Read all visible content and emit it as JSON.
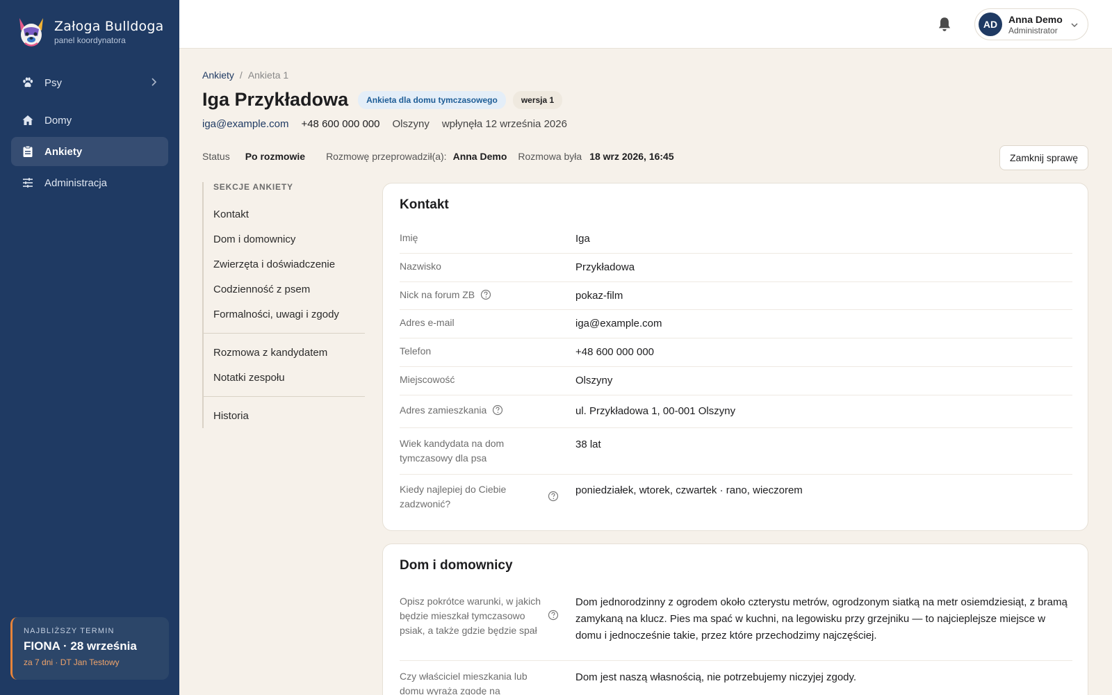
{
  "brand": {
    "title": "Załoga Bulldoga",
    "subtitle": "panel koordynatora"
  },
  "nav": [
    {
      "label": "Psy",
      "icon": "paw-icon"
    },
    {
      "label": "Domy",
      "icon": "home-icon"
    },
    {
      "label": "Ankiety",
      "icon": "clipboard-icon"
    },
    {
      "label": "Administracja",
      "icon": "sliders-icon"
    }
  ],
  "deadline": {
    "label": "NAJBLIŻSZY TERMIN",
    "title": "FIONA · 28 września",
    "meta": "za 7 dni · DT Jan Testowy"
  },
  "user": {
    "initials": "AD",
    "name": "Anna Demo",
    "role": "Administrator"
  },
  "breadcrumb": {
    "root": "Ankiety",
    "sep": "/",
    "current": "Ankieta 1"
  },
  "header": {
    "title": "Iga Przykładowa",
    "type_badge": "Ankieta dla domu tymczasowego",
    "version_badge": "wersja 1",
    "email": "iga@example.com",
    "phone": "+48 600 000 000",
    "city": "Olszyny",
    "submitted": "wpłynęła 12 września 2026"
  },
  "status": {
    "status_label": "Status",
    "status_value": "Po rozmowie",
    "interviewer_label": "Rozmowę przeprowadził(a):",
    "interviewer_value": "Anna Demo",
    "date_label": "Rozmowa była",
    "date_value": "18 wrz 2026, 16:45",
    "close_button": "Zamknij sprawę"
  },
  "sections": {
    "heading": "SEKCJE ANKIETY",
    "group1": [
      "Kontakt",
      "Dom i domownicy",
      "Zwierzęta i doświadczenie",
      "Codzienność z psem",
      "Formalności, uwagi i zgody"
    ],
    "group2": [
      "Rozmowa z kandydatem",
      "Notatki zespołu"
    ],
    "group3": [
      "Historia"
    ]
  },
  "contact": {
    "title": "Kontakt",
    "rows": [
      {
        "label": "Imię",
        "value": "Iga"
      },
      {
        "label": "Nazwisko",
        "value": "Przykładowa"
      },
      {
        "label": "Nick na forum ZB",
        "value": "pokaz-film"
      },
      {
        "label": "Adres e-mail",
        "value": "iga@example.com"
      },
      {
        "label": "Telefon",
        "value": "+48 600 000 000"
      },
      {
        "label": "Miejscowość",
        "value": "Olszyny"
      },
      {
        "label": "Adres zamieszkania",
        "value": "ul. Przykładowa 1, 00-001 Olszyny"
      },
      {
        "label": "Wiek kandydata na dom tymczasowy dla psa",
        "value": "38 lat"
      },
      {
        "label": "Kiedy najlepiej do Ciebie zadzwonić?",
        "value": "poniedziałek, wtorek, czwartek · rano, wieczorem"
      }
    ]
  },
  "home": {
    "title": "Dom i domownicy",
    "rows": [
      {
        "label": "Opisz pokrótce warunki, w jakich będzie mieszkał tymczasowo psiak, a także gdzie będzie spał",
        "value": "Dom jednorodzinny z ogrodem około czterystu metrów, ogrodzonym siatką na metr osiemdziesiąt, z bramą zamykaną na klucz. Pies ma spać w kuchni, na legowisku przy grzejniku — to najcieplejsze miejsce w domu i jednocześnie takie, przez które przechodzimy najczęściej."
      },
      {
        "label": "Czy właściciel mieszkania lub domu wyraża zgodę na prowadzenie przez Ciebie domu tymczasowego?",
        "value": "Dom jest naszą własnością, nie potrzebujemy niczyjej zgody."
      }
    ]
  }
}
